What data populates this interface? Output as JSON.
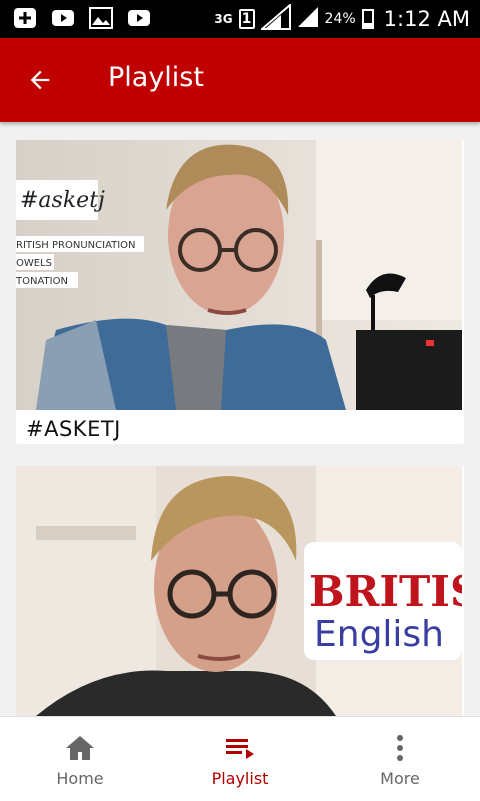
{
  "status_bar": {
    "network": "3G",
    "sim_slot": "1",
    "battery": "24%",
    "battery_level": 0.24,
    "time": "1:12 AM",
    "icons": [
      "whatsapp-icon",
      "youtube-icon",
      "gallery-icon",
      "youtube-icon"
    ]
  },
  "app_bar": {
    "title": "Playlist",
    "back_icon": "arrow-back-icon",
    "color": "#c00000"
  },
  "playlists": [
    {
      "title": "#ASKETJ",
      "thumbnail_caption": "#asketj",
      "thumbnail_lines": [
        "RITISH PRONUNCIATION",
        "OWELS",
        "TONATION"
      ]
    },
    {
      "title": "",
      "thumbnail_caption_1": "BRITISH",
      "thumbnail_caption_2": "English"
    }
  ],
  "bottom_nav": {
    "items": [
      {
        "label": "Home",
        "icon": "home-icon",
        "active": false
      },
      {
        "label": "Playlist",
        "icon": "playlist-icon",
        "active": true
      },
      {
        "label": "More",
        "icon": "more-vert-icon",
        "active": false
      }
    ],
    "active_color": "#b00000"
  }
}
